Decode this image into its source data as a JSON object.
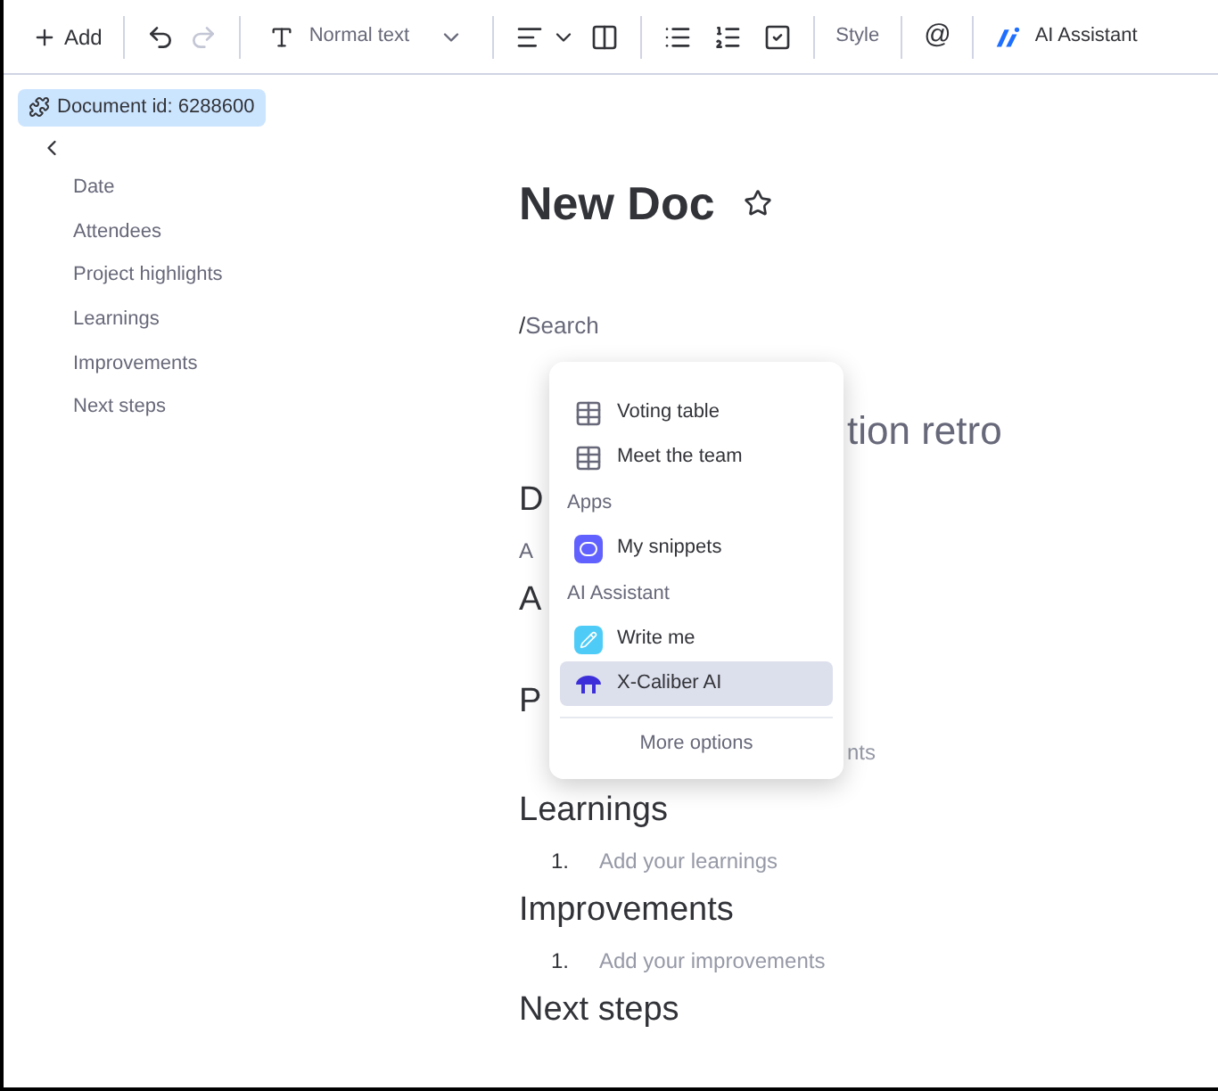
{
  "toolbar": {
    "add": "Add",
    "text_style": "Normal text",
    "style": "Style",
    "at": "@",
    "ai": "AI Assistant"
  },
  "doc_badge": "Document id: 6288600",
  "outline": [
    "Date",
    "Attendees",
    "Project highlights",
    "Learnings",
    "Improvements",
    "Next steps"
  ],
  "document": {
    "title": "New Doc",
    "starred": false,
    "command": "/",
    "search_placeholder": "Search",
    "peeking": [
      {
        "kind": "title",
        "text": "tion retro"
      },
      {
        "kind": "heading",
        "text": "D"
      },
      {
        "kind": "body",
        "text": "A"
      },
      {
        "kind": "heading",
        "text": "A"
      },
      {
        "kind": "heading",
        "text": "P"
      },
      {
        "kind": "tail",
        "text": "nts"
      }
    ],
    "sections": [
      {
        "heading": "Learnings",
        "number": "1.",
        "placeholder": "Add your learnings"
      },
      {
        "heading": "Improvements",
        "number": "1.",
        "placeholder": "Add your improvements"
      },
      {
        "heading": "Next steps"
      }
    ]
  },
  "menu": {
    "items": [
      {
        "kind": "table",
        "label": "Voting table",
        "selected": false
      },
      {
        "kind": "table",
        "label": "Meet the team",
        "selected": false
      },
      {
        "kind": "group",
        "label": "Apps"
      },
      {
        "kind": "snippets",
        "label": "My snippets",
        "selected": false
      },
      {
        "kind": "group",
        "label": "AI Assistant"
      },
      {
        "kind": "pencil",
        "label": "Write me",
        "selected": false
      },
      {
        "kind": "ai",
        "label": "X-Caliber AI",
        "selected": true
      }
    ],
    "footer": "More options"
  }
}
